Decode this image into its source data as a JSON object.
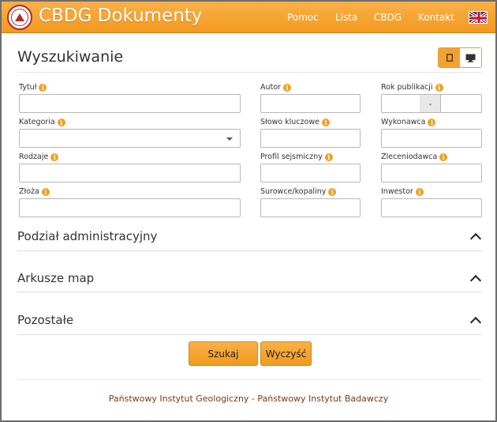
{
  "header": {
    "app_title": "CBDG Dokumenty",
    "nav": [
      "Pomoc",
      "Lista",
      "CBDG",
      "Kontakt"
    ],
    "language_icon": "uk-flag-icon"
  },
  "search": {
    "title": "Wyszukiwanie",
    "fields": {
      "tytul": "Tytuł",
      "autor": "Autor",
      "rok": "Rok publikacji",
      "rok_separator": "-",
      "kategoria": "Kategoria",
      "slowo": "Słowo kluczowe",
      "wykonawca": "Wykonawca",
      "rodzaje": "Rodzaje",
      "profil": "Profil sejsmiczny",
      "zleceniodawca": "Zleceniodawca",
      "zloza": "Złoża",
      "surowce": "Surowce/kopaliny",
      "inwestor": "Inwestor"
    },
    "info_glyph": "i"
  },
  "sections": [
    "Podział administracyjny",
    "Arkusze map",
    "Pozostałe"
  ],
  "buttons": {
    "search": "Szukaj",
    "clear": "Wyczyść"
  },
  "footer": "Państwowy Instytut Geologiczny - Państwowy Instytut Badawczy",
  "colors": {
    "accent": "#f39a1e",
    "footer_text": "#7a3a10"
  }
}
